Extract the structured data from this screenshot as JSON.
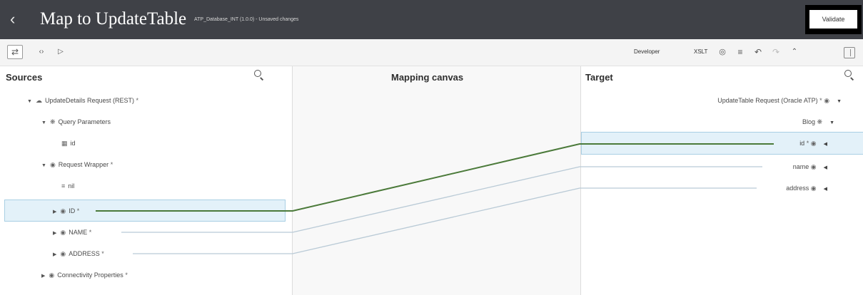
{
  "header": {
    "back_icon": "chevron-left-icon",
    "title": "Map to UpdateTable",
    "subtitle": "ATP_Database_INT (1.0.0) - Unsaved changes",
    "validate_label": "Validate"
  },
  "toolbar": {
    "left_icons": [
      "swap-icon",
      "code-icon",
      "play-icon"
    ],
    "developer_label": "Developer",
    "xslt_label": "XSLT",
    "right_icons": [
      "view-icon",
      "filter-icon",
      "undo-icon",
      "redo-icon",
      "collapse-icon",
      "panel-icon"
    ]
  },
  "sources": {
    "title": "Sources",
    "rows": [
      {
        "label": "UpdateDetails Request (REST)",
        "star": "*",
        "icon": "rest-icon",
        "caret": "down"
      },
      {
        "label": "Query Parameters",
        "icon": "params-icon",
        "caret": "down"
      },
      {
        "label": "id",
        "icon": "field-icon"
      },
      {
        "label": "Request Wrapper",
        "star": "*",
        "icon": "element-icon",
        "caret": "down"
      },
      {
        "label": "nil",
        "icon": "attribute-icon"
      },
      {
        "label": "ID",
        "star": "*",
        "icon": "element-icon",
        "caret": "right"
      },
      {
        "label": "NAME",
        "star": "*",
        "icon": "element-icon",
        "caret": "right"
      },
      {
        "label": "ADDRESS",
        "star": "*",
        "icon": "element-icon",
        "caret": "right"
      },
      {
        "label": "Connectivity Properties",
        "star": "*",
        "icon": "element-icon",
        "caret": "right"
      }
    ]
  },
  "canvas": {
    "title": "Mapping canvas"
  },
  "target": {
    "title": "Target",
    "rows": [
      {
        "label": "UpdateTable Request (Oracle ATP)",
        "star": "*",
        "icon": "element-icon"
      },
      {
        "label": "Blog",
        "icon": "params-icon"
      },
      {
        "label": "id",
        "star": "*",
        "icon": "element-icon"
      },
      {
        "label": "name",
        "icon": "element-icon"
      },
      {
        "label": "address",
        "icon": "element-icon"
      }
    ]
  },
  "colors": {
    "header_bg": "#3f4147",
    "mapped_line": "#4b7a3a",
    "unmapped_line": "#b9cad6",
    "highlight": "#e3f1f9"
  }
}
